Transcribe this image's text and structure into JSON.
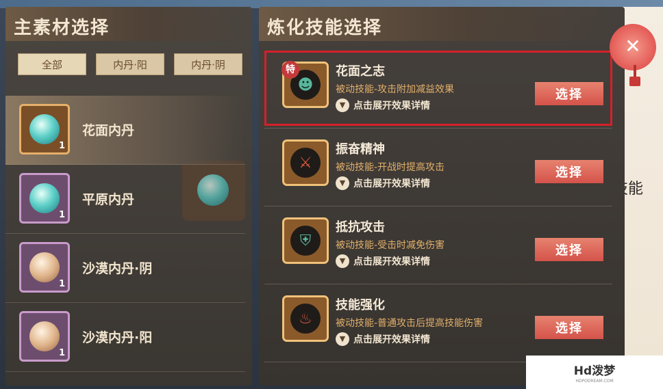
{
  "left_panel": {
    "title": "主素材选择",
    "filters": [
      "全部",
      "内丹·阳",
      "内丹·阴"
    ],
    "materials": [
      {
        "name": "花面内丹",
        "count": "1",
        "frame": "gold",
        "orb": "teal",
        "selected": true
      },
      {
        "name": "平原内丹",
        "count": "1",
        "frame": "purple",
        "orb": "teal",
        "selected": false
      },
      {
        "name": "沙漠内丹·阴",
        "count": "1",
        "frame": "purple",
        "orb": "tan",
        "selected": false
      },
      {
        "name": "沙漠内丹·阳",
        "count": "1",
        "frame": "purple",
        "orb": "tan",
        "selected": false
      }
    ]
  },
  "right_panel": {
    "title": "炼化技能选择",
    "skills": [
      {
        "name": "花面之志",
        "desc": "被动技能-攻击附加减益效果",
        "expand": "点击展开效果详情",
        "button": "选择",
        "badge": "特",
        "icon": "mask-icon"
      },
      {
        "name": "振奋精神",
        "desc": "被动技能-开战时提高攻击",
        "expand": "点击展开效果详情",
        "button": "选择",
        "icon": "sword-icon"
      },
      {
        "name": "抵抗攻击",
        "desc": "被动技能-受击时减免伤害",
        "expand": "点击展开效果详情",
        "button": "选择",
        "icon": "shield-icon"
      },
      {
        "name": "技能强化",
        "desc": "被动技能-普通攻击后提高技能伤害",
        "expand": "点击展开效果详情",
        "button": "选择",
        "icon": "flame-icon"
      }
    ]
  },
  "background_text": "选择炼化的技能",
  "close_icon": "x-icon",
  "watermark": {
    "main": "Hd泼梦",
    "sub": "HDPODREAM.COM"
  },
  "colors": {
    "select_button": "#d4534a",
    "highlight_border": "#d5202a",
    "desc_text": "#e2b06b",
    "badge": "#c4393b"
  }
}
